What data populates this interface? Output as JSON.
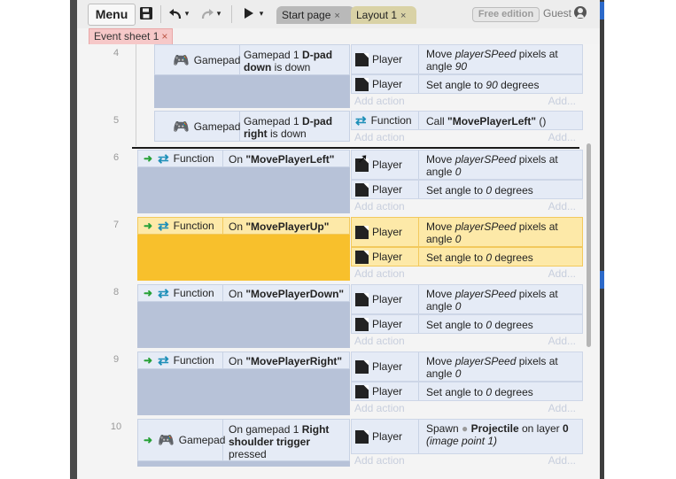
{
  "toolbar": {
    "menu_label": "Menu",
    "save_icon": "save-icon",
    "undo_icon": "undo-icon",
    "redo_icon": "redo-icon",
    "play_icon": "play-icon",
    "dropdown_glyph": "▾",
    "tabs": [
      {
        "label": "Start page",
        "close": "×"
      },
      {
        "label": "Layout 1",
        "close": "×"
      }
    ],
    "free_edition_label": "Free edition",
    "guest_label": "Guest"
  },
  "sheet_tab": {
    "label": "Event sheet 1",
    "close": "×"
  },
  "add_action_label": "Add action",
  "add_more_label": "Add...",
  "colors": {
    "selected_row": "#f8c02c",
    "condition_bg": "#e5ebf6",
    "accent": "#1d8fb8"
  },
  "events": [
    {
      "number": "4",
      "condition": {
        "object": "Gamepad",
        "text_a": "Gamepad 1 ",
        "bold_a": "D-pad",
        "text_b": "",
        "bold_b": "down",
        "text_c": " is down"
      },
      "actions": [
        {
          "object": "Player",
          "pre": "Move ",
          "em": "playerSPeed",
          "mid": " pixels at angle ",
          "em2": "90"
        },
        {
          "object": "Player",
          "pre": "Set angle to ",
          "em": "90",
          "mid": " degrees",
          "em2": ""
        }
      ]
    },
    {
      "number": "5",
      "condition": {
        "object": "Gamepad",
        "text_a": "Gamepad 1 ",
        "bold_a": "D-pad",
        "text_b": "",
        "bold_b": "right",
        "text_c": " is down"
      },
      "actions": [
        {
          "object": "Function",
          "pre": "Call ",
          "bold": "\"MovePlayerLeft\"",
          "post": " ()"
        }
      ]
    },
    {
      "number": "6",
      "condition": {
        "object": "Function",
        "pre": "On ",
        "bold": "\"MovePlayerLeft\""
      },
      "actions": [
        {
          "object": "Player",
          "pre": "Move ",
          "em": "playerSPeed",
          "mid": " pixels at angle ",
          "em2": "0"
        },
        {
          "object": "Player",
          "pre": "Set angle to ",
          "em": "0",
          "mid": " degrees",
          "em2": ""
        }
      ]
    },
    {
      "number": "7",
      "selected": true,
      "condition": {
        "object": "Function",
        "pre": "On ",
        "bold": "\"MovePlayerUp\""
      },
      "actions": [
        {
          "object": "Player",
          "pre": "Move ",
          "em": "playerSPeed",
          "mid": " pixels at angle ",
          "em2": "0"
        },
        {
          "object": "Player",
          "pre": "Set angle to ",
          "em": "0",
          "mid": " degrees",
          "em2": ""
        }
      ]
    },
    {
      "number": "8",
      "condition": {
        "object": "Function",
        "pre": "On ",
        "bold": "\"MovePlayerDown\""
      },
      "actions": [
        {
          "object": "Player",
          "pre": "Move ",
          "em": "playerSPeed",
          "mid": " pixels at angle ",
          "em2": "0"
        },
        {
          "object": "Player",
          "pre": "Set angle to ",
          "em": "0",
          "mid": " degrees",
          "em2": ""
        }
      ]
    },
    {
      "number": "9",
      "condition": {
        "object": "Function",
        "pre": "On ",
        "bold": "\"MovePlayerRight\""
      },
      "actions": [
        {
          "object": "Player",
          "pre": "Move ",
          "em": "playerSPeed",
          "mid": " pixels at angle ",
          "em2": "0"
        },
        {
          "object": "Player",
          "pre": "Set angle to ",
          "em": "0",
          "mid": " degrees",
          "em2": ""
        }
      ]
    },
    {
      "number": "10",
      "condition": {
        "object": "Gamepad",
        "text_a": "On gamepad 1 ",
        "bold_a": "Right shoulder trigger",
        "text_c": " pressed"
      },
      "actions": [
        {
          "object": "Player",
          "pre": "Spawn ",
          "bold": "Projectile",
          "mid": " on layer ",
          "bold2": "0",
          "em": "(image point 1)"
        }
      ]
    }
  ]
}
